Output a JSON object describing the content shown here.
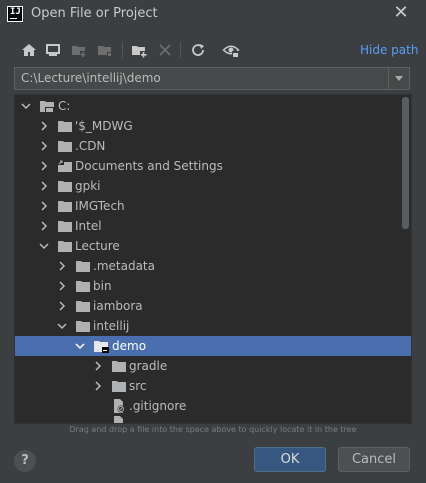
{
  "window": {
    "title": "Open File or Project",
    "close_icon": "close-icon"
  },
  "toolbar": {
    "icons": [
      "home-icon",
      "desktop-icon",
      "new-folder-icon",
      "delete-icon",
      "refresh-icon",
      "show-hidden-icon"
    ],
    "hide_path_label": "Hide path"
  },
  "path": {
    "value": "C:\\Lecture\\intellij\\demo"
  },
  "tree": {
    "root": {
      "label": "C:"
    },
    "items": [
      {
        "label": "'$_MDWG"
      },
      {
        "label": ".CDN"
      },
      {
        "label": "Documents and Settings"
      },
      {
        "label": "gpki"
      },
      {
        "label": "IMGTech"
      },
      {
        "label": "Intel"
      },
      {
        "label": "Lecture"
      },
      {
        "label": ".metadata"
      },
      {
        "label": "bin"
      },
      {
        "label": "iambora"
      },
      {
        "label": "intellij"
      },
      {
        "label": "demo"
      },
      {
        "label": "gradle"
      },
      {
        "label": "src"
      },
      {
        "label": ".gitignore"
      }
    ]
  },
  "hint": "Drag and drop a file into the space above to quickly locate it in the tree",
  "buttons": {
    "help": "?",
    "ok": "OK",
    "cancel": "Cancel"
  },
  "colors": {
    "accent": "#589df6",
    "selection": "#4b6eaf",
    "ok_button": "#365880"
  }
}
